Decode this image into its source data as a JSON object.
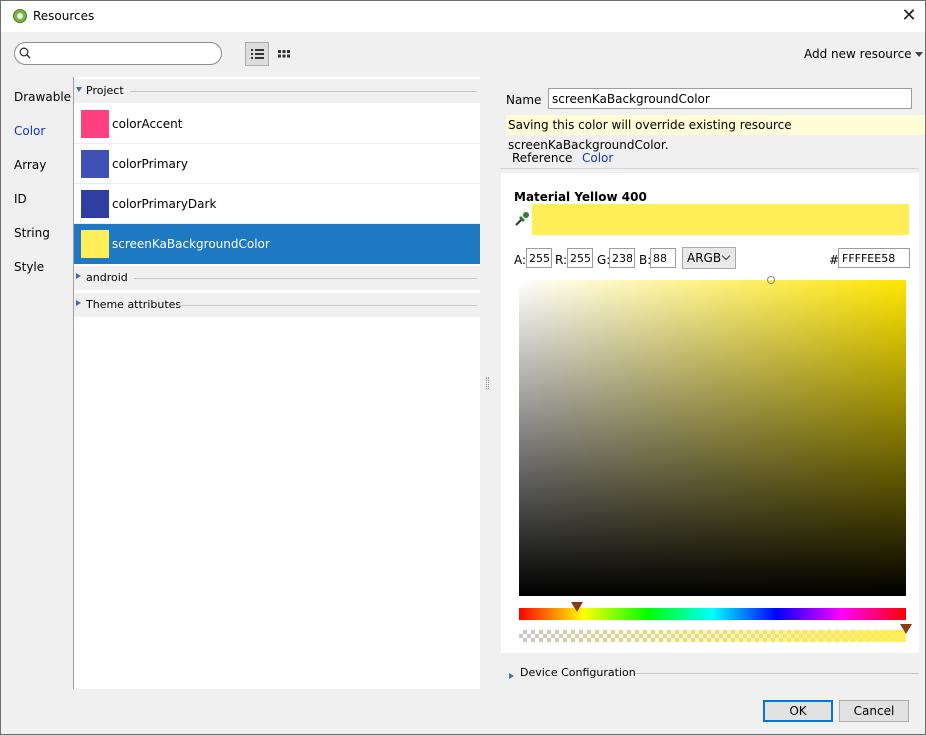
{
  "window": {
    "title": "Resources"
  },
  "toolbar": {
    "search_value": "",
    "add_resource_label": "Add new resource"
  },
  "nav": {
    "items": [
      "Drawable",
      "Color",
      "Array",
      "ID",
      "String",
      "Style"
    ],
    "selected": "Color"
  },
  "resources": {
    "groups": [
      {
        "label": "Project",
        "expanded": true
      },
      {
        "label": "android",
        "expanded": false
      },
      {
        "label": "Theme attributes",
        "expanded": false
      }
    ],
    "items": [
      {
        "name": "colorAccent",
        "color": "#ff4081",
        "selected": false
      },
      {
        "name": "colorPrimary",
        "color": "#3f51b5",
        "selected": false
      },
      {
        "name": "colorPrimaryDark",
        "color": "#303f9f",
        "selected": false
      },
      {
        "name": "screenKaBackgroundColor",
        "color": "#ffee58",
        "selected": true
      }
    ]
  },
  "editor": {
    "name_label": "Name",
    "name_value": "screenKaBackgroundColor",
    "warning": "Saving this color will override existing resource screenKaBackgroundColor.",
    "tabs": [
      "Reference",
      "Color"
    ],
    "active_tab": "Color",
    "material_name": "Material Yellow 400",
    "preview_color": "#ffee58",
    "channels": [
      {
        "label": "A:",
        "value": "255"
      },
      {
        "label": "R:",
        "value": "255"
      },
      {
        "label": "G:",
        "value": "238"
      },
      {
        "label": "B:",
        "value": "88"
      }
    ],
    "mode": "ARGB",
    "hash": "#",
    "hex": "FFFFEE58",
    "hue_color": "#ffe600",
    "saturation": 0.65,
    "brightness": 1.0,
    "hue_fraction": 0.15,
    "alpha_fraction": 1.0,
    "device_config_label": "Device Configuration"
  },
  "footer": {
    "ok_label": "OK",
    "cancel_label": "Cancel"
  },
  "colors": {
    "selection": "#1e79c2",
    "accent_text": "#1a33c4",
    "warning_bg": "#fffdd6"
  }
}
